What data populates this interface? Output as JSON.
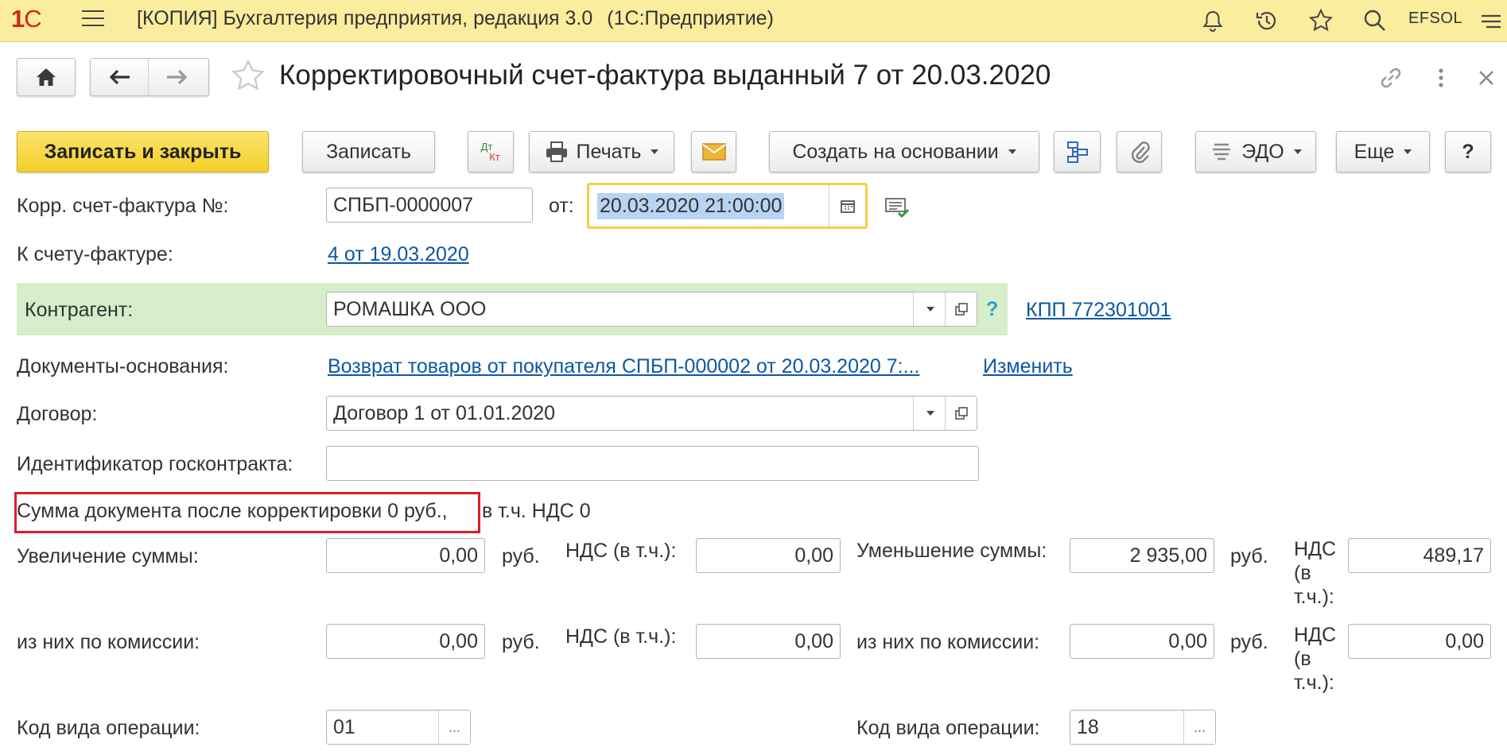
{
  "topbar": {
    "logo_main": "1",
    "logo_c": "С",
    "app_title": "[КОПИЯ] Бухгалтерия предприятия, редакция 3.0",
    "platform": "(1С:Предприятие)",
    "user": "EFSOL",
    "icons": [
      "bell-icon",
      "history-icon",
      "star-icon",
      "search-icon",
      "menu-icon"
    ]
  },
  "title_row": {
    "title": "Корректировочный счет-фактура выданный 7 от 20.03.2020",
    "icons": [
      "home-icon",
      "back-arrow-icon",
      "forward-arrow-icon",
      "favorite-star-icon",
      "link-icon",
      "more-icon",
      "close-icon"
    ]
  },
  "toolbar": {
    "save_close": "Записать и закрыть",
    "save": "Записать",
    "dtkt_top": "Дт",
    "dtkt_bottom": "Кт",
    "print": "Печать",
    "create_based": "Создать на основании",
    "edo": "ЭДО",
    "more": "Еще",
    "help": "?"
  },
  "form": {
    "corr_invoice_label": "Корр. счет-фактура №:",
    "corr_invoice_number": "СПБП-0000007",
    "from_label": "от:",
    "date_value": "20.03.2020 21:00:00",
    "to_invoice_label": "К счету-фактуре:",
    "to_invoice_link": "4 от 19.03.2020",
    "counterparty_label": "Контрагент:",
    "counterparty_value": "РОМАШКА ООО",
    "counterparty_help": "?",
    "kpp_link": "КПП 772301001",
    "base_docs_label": "Документы-основания:",
    "base_docs_link": "Возврат товаров от покупателя СПБП-000002 от 20.03.2020 7:...",
    "change_link": "Изменить",
    "contract_label": "Договор:",
    "contract_value": "Договор 1 от 01.01.2020",
    "gov_contract_label": "Идентификатор госконтракта:",
    "gov_contract_value": "",
    "summary_highlight": "Сумма документа после корректировки 0 руб.,",
    "summary_rest": "в т.ч. НДС 0",
    "increase_label": "Увеличение суммы:",
    "increase_value": "0,00",
    "rub": "руб.",
    "vat_incl_label": "НДС (в т.ч.):",
    "increase_vat": "0,00",
    "decrease_label": "Уменьшение суммы:",
    "decrease_value": "2 935,00",
    "vat_incl_stacked": [
      "НДС",
      "(в",
      "т.ч.):"
    ],
    "decrease_vat": "489,17",
    "commission_label": "из них по комиссии:",
    "commission_inc_value": "0,00",
    "commission_inc_vat": "0,00",
    "commission_dec_value": "0,00",
    "commission_dec_vat": "0,00",
    "op_code_label": "Код вида операции:",
    "op_code_left": "01",
    "op_code_right": "18",
    "ellipsis": "..."
  }
}
